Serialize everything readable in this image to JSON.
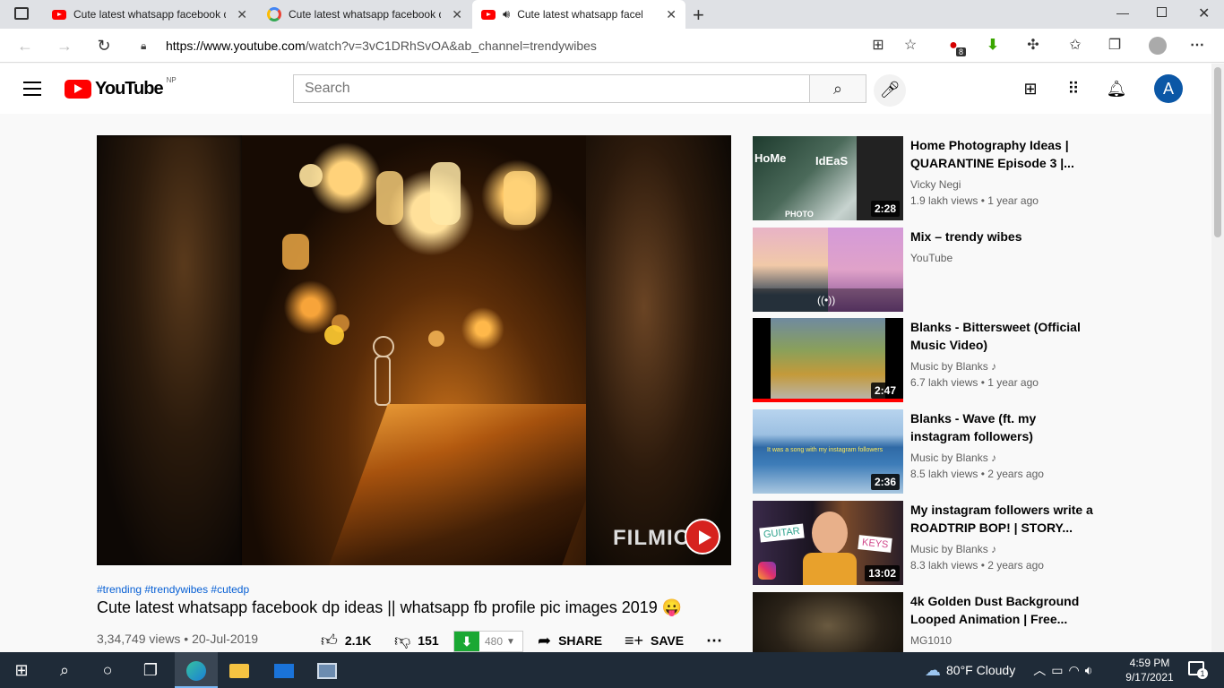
{
  "browser": {
    "tabs": [
      {
        "title": "Cute latest whatsapp facebook d",
        "favicon": "youtube-icon",
        "active": false
      },
      {
        "title": "Cute latest whatsapp facebook d",
        "favicon": "google-icon",
        "active": false
      },
      {
        "title": "Cute latest whatsapp facebo",
        "favicon": "youtube-icon",
        "active": true,
        "audio": true
      }
    ],
    "url_domain": "https://www.youtube.com",
    "url_path": "/watch?v=3vC1DRhSvOA&ab_channel=trendywibes",
    "extension_badge": "8"
  },
  "youtube": {
    "logo_text": "YouTube",
    "region": "NP",
    "search_placeholder": "Search",
    "avatar_letter": "A"
  },
  "video": {
    "hashtags": "#trending #trendywibes #cutedp",
    "title": "Cute latest whatsapp facebook dp ideas || whatsapp fb profile pic images 2019 😛",
    "views": "3,34,749 views",
    "date": "20-Jul-2019",
    "likes": "2.1K",
    "dislikes": "151",
    "download_count": "480",
    "share_label": "SHARE",
    "save_label": "SAVE",
    "watermark": "FILMIC"
  },
  "recommendations": [
    {
      "title": "Home Photography Ideas | QUARANTINE Episode 3 |...",
      "channel": "Vicky Negi",
      "views": "1.9 lakh views • 1 year ago",
      "duration": "2:28",
      "music": false
    },
    {
      "title": "Mix – trendy wibes",
      "channel": "YouTube",
      "views": "",
      "duration": "",
      "music": false
    },
    {
      "title": "Blanks - Bittersweet (Official Music Video)",
      "channel": "Music by Blanks",
      "views": "6.7 lakh views • 1 year ago",
      "duration": "2:47",
      "music": true
    },
    {
      "title": "Blanks - Wave (ft. my instagram followers)",
      "channel": "Music by Blanks",
      "views": "8.5 lakh views • 2 years ago",
      "duration": "2:36",
      "music": true
    },
    {
      "title": "My instagram followers write a ROADTRIP BOP! | STORY...",
      "channel": "Music by Blanks",
      "views": "8.3 lakh views • 2 years ago",
      "duration": "13:02",
      "music": true
    },
    {
      "title": "4k Golden Dust Background Looped Animation | Free...",
      "channel": "MG1010",
      "views": "",
      "duration": "",
      "music": false
    }
  ],
  "thumb_text": {
    "home": "HoMe",
    "ideas": "IdEaS",
    "photo": "PHOTO",
    "wave": "It was a song with my instagram followers",
    "guitar": "GUITAR",
    "keys": "KEYS"
  },
  "taskbar": {
    "weather": "80°F  Cloudy",
    "time": "4:59 PM",
    "date": "9/17/2021",
    "notifications": "1"
  }
}
